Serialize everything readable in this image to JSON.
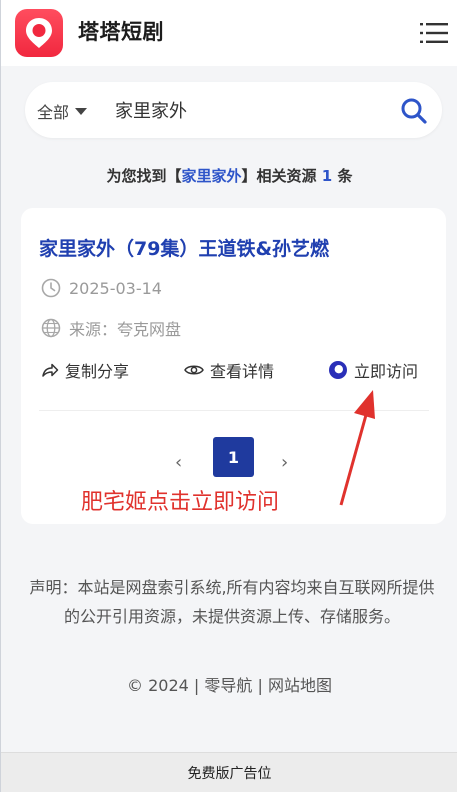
{
  "header": {
    "brand": "塔塔短剧",
    "logo_icon": "location-pin-icon",
    "menu_icon": "hamburger-menu-icon"
  },
  "search": {
    "scope_label": "全部",
    "query": "家里家外",
    "search_icon": "search-icon"
  },
  "results_summary": {
    "prefix": "为您找到【",
    "keyword": "家里家外",
    "middle": "】相关资源",
    "count": "1",
    "suffix": "条"
  },
  "results": [
    {
      "title": "家里家外（79集）王道铁&孙艺燃",
      "date": "2025-03-14",
      "source": "来源：夸克网盘",
      "actions": {
        "copy_share": "复制分享",
        "view_details": "查看详情",
        "visit_now": "立即访问"
      }
    }
  ],
  "pagination": {
    "prev": "‹",
    "current": "1",
    "next": "›"
  },
  "annotation": "肥宅姬点击立即访问",
  "footer": {
    "disclaimer": "声明：本站是网盘索引系统,所有内容均来自互联网所提供的公开引用资源，未提供资源上传、存储服务。",
    "copyright": "© 2024",
    "link_home": "零导航",
    "link_sitemap": "网站地图",
    "separator": "|"
  },
  "ad_bar": "免费版广告位",
  "colors": {
    "brand_red": "#f1283f",
    "link_blue": "#2040b0",
    "pager_blue": "#1f3a9e",
    "annotation_red": "#e0322d"
  }
}
